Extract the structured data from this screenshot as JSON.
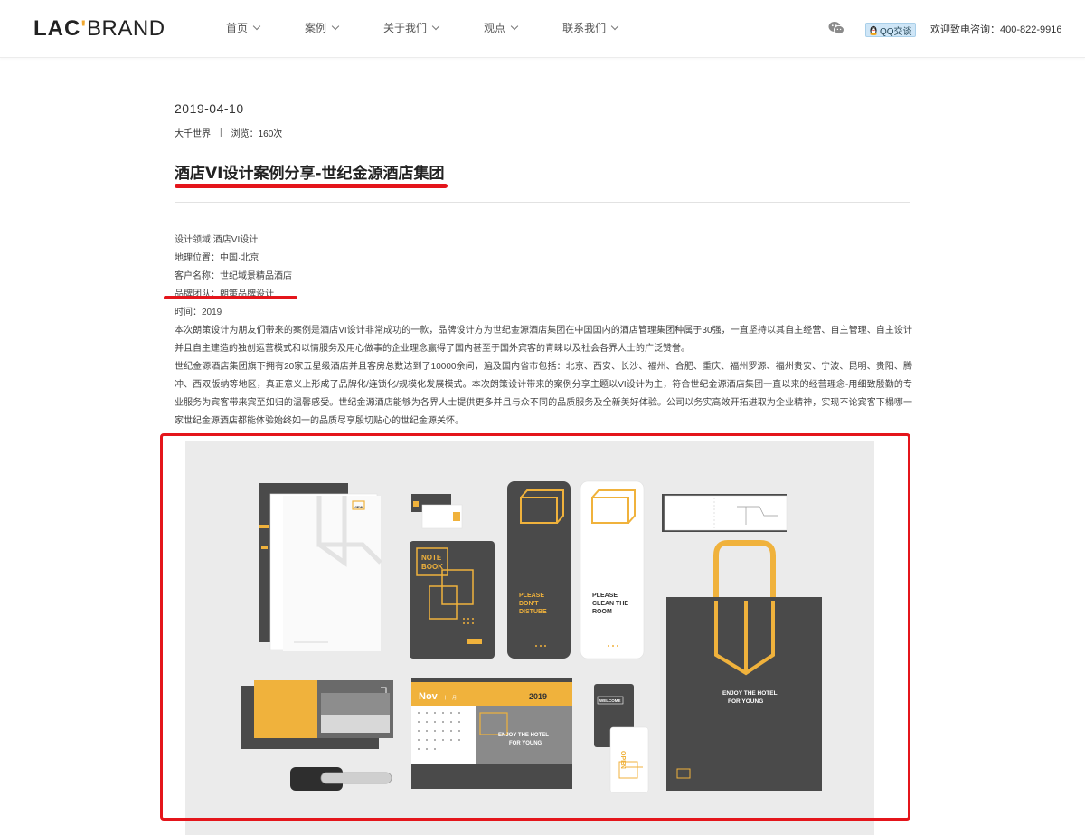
{
  "header": {
    "logo": {
      "lac": "LAC",
      "mark": "'",
      "brand": "BRAND"
    },
    "nav": [
      {
        "label": "首页"
      },
      {
        "label": "案例"
      },
      {
        "label": "关于我们"
      },
      {
        "label": "观点"
      },
      {
        "label": "联系我们"
      }
    ],
    "qq_label": "QQ交谈",
    "hotline": "欢迎致电咨询：400-822-9916"
  },
  "article": {
    "date": "2019-04-10",
    "category": "大千世界",
    "separator": "|",
    "views": "浏览：160次",
    "title": "酒店VI设计案例分享-世纪金源酒店集团",
    "info": [
      "设计领域:酒店VI设计",
      "地理位置：中国·北京",
      "客户名称：世纪域景精品酒店",
      "品牌团队：朗策品牌设计",
      "时间：2019"
    ],
    "paragraphs": [
      "本次朗策设计为朋友们带来的案例是酒店VI设计非常成功的一款，品牌设计方为世纪金源酒店集团在中国国内的酒店管理集团种属于30强，一直坚持以其自主经营、自主管理、自主设计并且自主建造的独创运营模式和以情服务及用心做事的企业理念赢得了国内甚至于国外宾客的青睐以及社会各界人士的广泛赞誉。",
      "世纪金源酒店集团旗下拥有20家五星级酒店并且客房总数达到了10000余间，遍及国内省市包括：北京、西安、长沙、福州、合肥、重庆、福州罗源、福州贵安、宁波、昆明、贵阳、腾冲、西双版纳等地区，真正意义上形成了品牌化/连锁化/规模化发展模式。本次朗策设计带来的案例分享主题以VI设计为主，符合世纪金源酒店集团一直以来的经营理念-用细致殷勤的专业服务为宾客带来宾至如归的温馨感受。世纪金源酒店能够为各界人士提供更多并且与众不同的品质服务及全新美好体验。公司以务实高效开拓进取为企业精神，实现不论宾客下榻哪一家世纪金源酒店都能体验始终如一的品质尽享殷切贴心的世纪金源关怀。"
    ]
  },
  "mockup": {
    "notebook": [
      "NOTE",
      "BOOK"
    ],
    "hanger_dnd": [
      "PLEASE",
      "DON'T",
      "DISTUBE"
    ],
    "hanger_clean": [
      "PLEASE",
      "CLEAN THE",
      "ROOM"
    ],
    "bag": [
      "ENJOY THE HOTEL",
      "FOR YOUNG"
    ],
    "calendar_month": "Nov",
    "calendar_month_cn": "十一月",
    "calendar_year": "2019",
    "calendar_slogan": [
      "ENJOY THE HOTEL",
      "FOR YOUNG"
    ],
    "keycard_welcome": "WELCOME",
    "keycard_open": "OPEN",
    "logo_text": "VIEW"
  },
  "colors": {
    "accent_red": "#e4151b",
    "brand_yellow": "#f0b23c",
    "dark_gray": "#4a4a4a",
    "bg_gray": "#ebebeb"
  }
}
